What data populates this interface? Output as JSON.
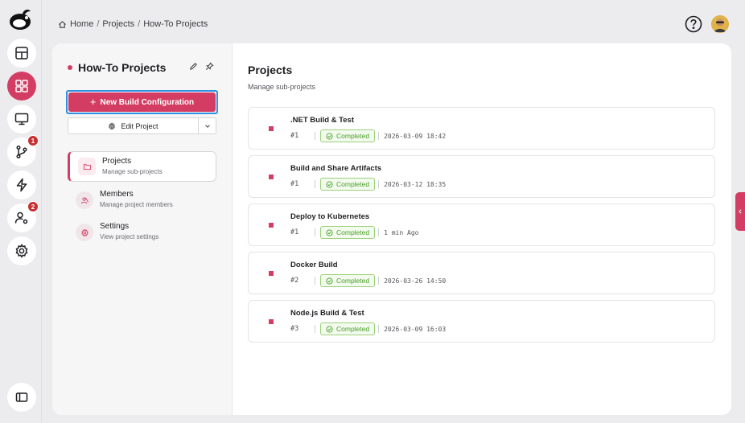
{
  "colors": {
    "accent": "#d43d63",
    "success": "#4a9e2a",
    "focus": "#2f8fe0"
  },
  "rail": {
    "items": [
      {
        "name": "dashboard-icon"
      },
      {
        "name": "apps-grid-icon",
        "active": true
      },
      {
        "name": "monitor-icon"
      },
      {
        "name": "git-branch-icon",
        "badge": "1"
      },
      {
        "name": "lightning-icon"
      },
      {
        "name": "user-settings-icon",
        "badge": "2"
      },
      {
        "name": "gear-icon"
      }
    ],
    "bottom": "sidebar-toggle-icon"
  },
  "breadcrumb": {
    "home": "Home",
    "sep": "/",
    "projects": "Projects",
    "current": "How-To Projects"
  },
  "project": {
    "title": "How-To Projects",
    "new_build_label": "New Build Configuration",
    "edit_label": "Edit Project"
  },
  "nav": [
    {
      "label": "Projects",
      "sub": "Manage sub-projects",
      "icon": "folder-icon",
      "active": true
    },
    {
      "label": "Members",
      "sub": "Manage project members",
      "icon": "members-icon"
    },
    {
      "label": "Settings",
      "sub": "View project settings",
      "icon": "gear-icon"
    }
  ],
  "content": {
    "title": "Projects",
    "subtitle": "Manage sub-projects",
    "rows": [
      {
        "name": ".NET Build & Test",
        "run": "#1",
        "status": "Completed",
        "time": "2026-03-09 18:42"
      },
      {
        "name": "Build and Share Artifacts",
        "run": "#1",
        "status": "Completed",
        "time": "2026-03-12 18:35"
      },
      {
        "name": "Deploy to Kubernetes",
        "run": "#1",
        "status": "Completed",
        "time": "1 min Ago"
      },
      {
        "name": "Docker Build",
        "run": "#2",
        "status": "Completed",
        "time": "2026-03-26 14:50"
      },
      {
        "name": "Node.js Build & Test",
        "run": "#3",
        "status": "Completed",
        "time": "2026-03-09 16:03"
      }
    ]
  }
}
